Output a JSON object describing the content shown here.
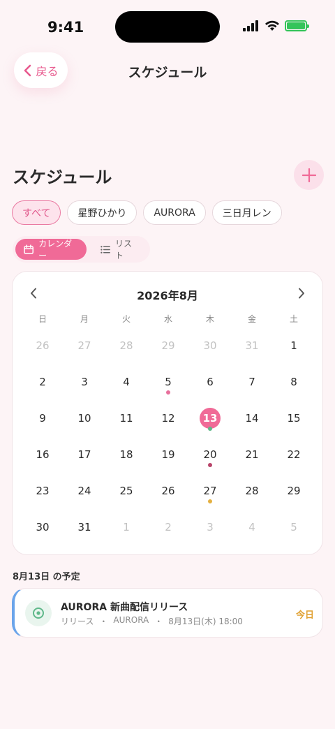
{
  "status_bar": {
    "time": "9:41"
  },
  "nav": {
    "back_label": "戻る",
    "title": "スケジュール"
  },
  "page": {
    "heading": "スケジュール"
  },
  "filters": [
    {
      "label": "すべて",
      "active": true
    },
    {
      "label": "星野ひかり",
      "active": false
    },
    {
      "label": "AURORA",
      "active": false
    },
    {
      "label": "三日月レン",
      "active": false
    }
  ],
  "view_toggle": {
    "calendar_label": "カレンダー",
    "list_label": "リスト",
    "selected": "calendar"
  },
  "calendar": {
    "month_label": "2026年8月",
    "weekdays": [
      "日",
      "月",
      "火",
      "水",
      "木",
      "金",
      "土"
    ],
    "days": [
      {
        "n": "26",
        "muted": true
      },
      {
        "n": "27",
        "muted": true
      },
      {
        "n": "28",
        "muted": true
      },
      {
        "n": "29",
        "muted": true
      },
      {
        "n": "30",
        "muted": true
      },
      {
        "n": "31",
        "muted": true
      },
      {
        "n": "1"
      },
      {
        "n": "2"
      },
      {
        "n": "3"
      },
      {
        "n": "4"
      },
      {
        "n": "5",
        "dot": "#e8709c"
      },
      {
        "n": "6"
      },
      {
        "n": "7"
      },
      {
        "n": "8"
      },
      {
        "n": "9"
      },
      {
        "n": "10"
      },
      {
        "n": "11"
      },
      {
        "n": "12"
      },
      {
        "n": "13",
        "today": true,
        "dot": "#5fb88a"
      },
      {
        "n": "14"
      },
      {
        "n": "15"
      },
      {
        "n": "16"
      },
      {
        "n": "17"
      },
      {
        "n": "18"
      },
      {
        "n": "19"
      },
      {
        "n": "20",
        "dot": "#b8456a"
      },
      {
        "n": "21"
      },
      {
        "n": "22"
      },
      {
        "n": "23"
      },
      {
        "n": "24"
      },
      {
        "n": "25"
      },
      {
        "n": "26"
      },
      {
        "n": "27",
        "dot": "#e4b040"
      },
      {
        "n": "28"
      },
      {
        "n": "29"
      },
      {
        "n": "30"
      },
      {
        "n": "31"
      },
      {
        "n": "1",
        "muted": true
      },
      {
        "n": "2",
        "muted": true
      },
      {
        "n": "3",
        "muted": true
      },
      {
        "n": "4",
        "muted": true
      },
      {
        "n": "5",
        "muted": true
      }
    ]
  },
  "events": {
    "heading": "8月13日 の予定",
    "items": [
      {
        "title": "AURORA 新曲配信リリース",
        "type": "リリース",
        "artist": "AURORA",
        "datetime": "8月13日(木) 18:00",
        "separator": "・",
        "badge": "今日",
        "icon": "target-icon"
      }
    ]
  },
  "colors": {
    "accent": "#f06a97",
    "background": "#fdf4f6",
    "event_accent_bar": "#6aa4ea",
    "today_badge": "#e0a030"
  }
}
